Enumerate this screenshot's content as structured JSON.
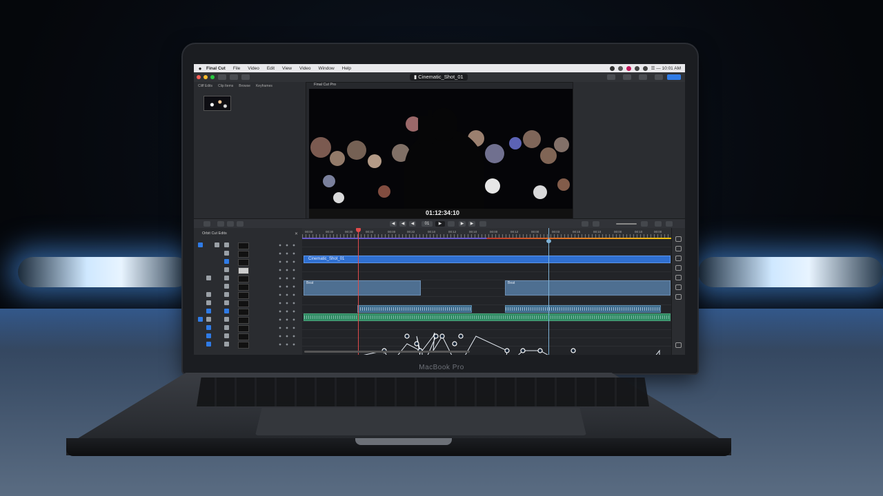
{
  "menubar": {
    "apple": "",
    "items": [
      "Final Cut",
      "File",
      "Video",
      "Edit",
      "View",
      "Video",
      "Window",
      "Help"
    ],
    "clock": "☰ — 10:01 AM"
  },
  "toolbar": {
    "title": "Cinematic_Shot_01"
  },
  "browser": {
    "tabs": [
      "Cliff Edits",
      "Clip Items",
      "Browse",
      "Keyframes"
    ]
  },
  "viewer": {
    "header": "Final Cut Pro",
    "timecode": "01:12:34:10"
  },
  "timeline": {
    "index_title": "Orbit Cut Edits",
    "ruler_labels": [
      "00:00",
      "00:30",
      "00:30",
      "00:33",
      "00:00",
      "00:22",
      "00:10",
      "00:12",
      "00:10",
      "00:00",
      "00:12",
      "00:00",
      "00:03",
      "00:15",
      "00:10",
      "00:00",
      "00:10",
      "00:00"
    ],
    "clip_main": "Cinematic_Shot_01",
    "clip_a": "Beat",
    "clip_b": "Beat"
  },
  "device": {
    "label": "MacBook Pro"
  },
  "colors": {
    "accent": "#2f7be6",
    "playhead": "#e14b4b",
    "audio": "#2f8b63"
  }
}
